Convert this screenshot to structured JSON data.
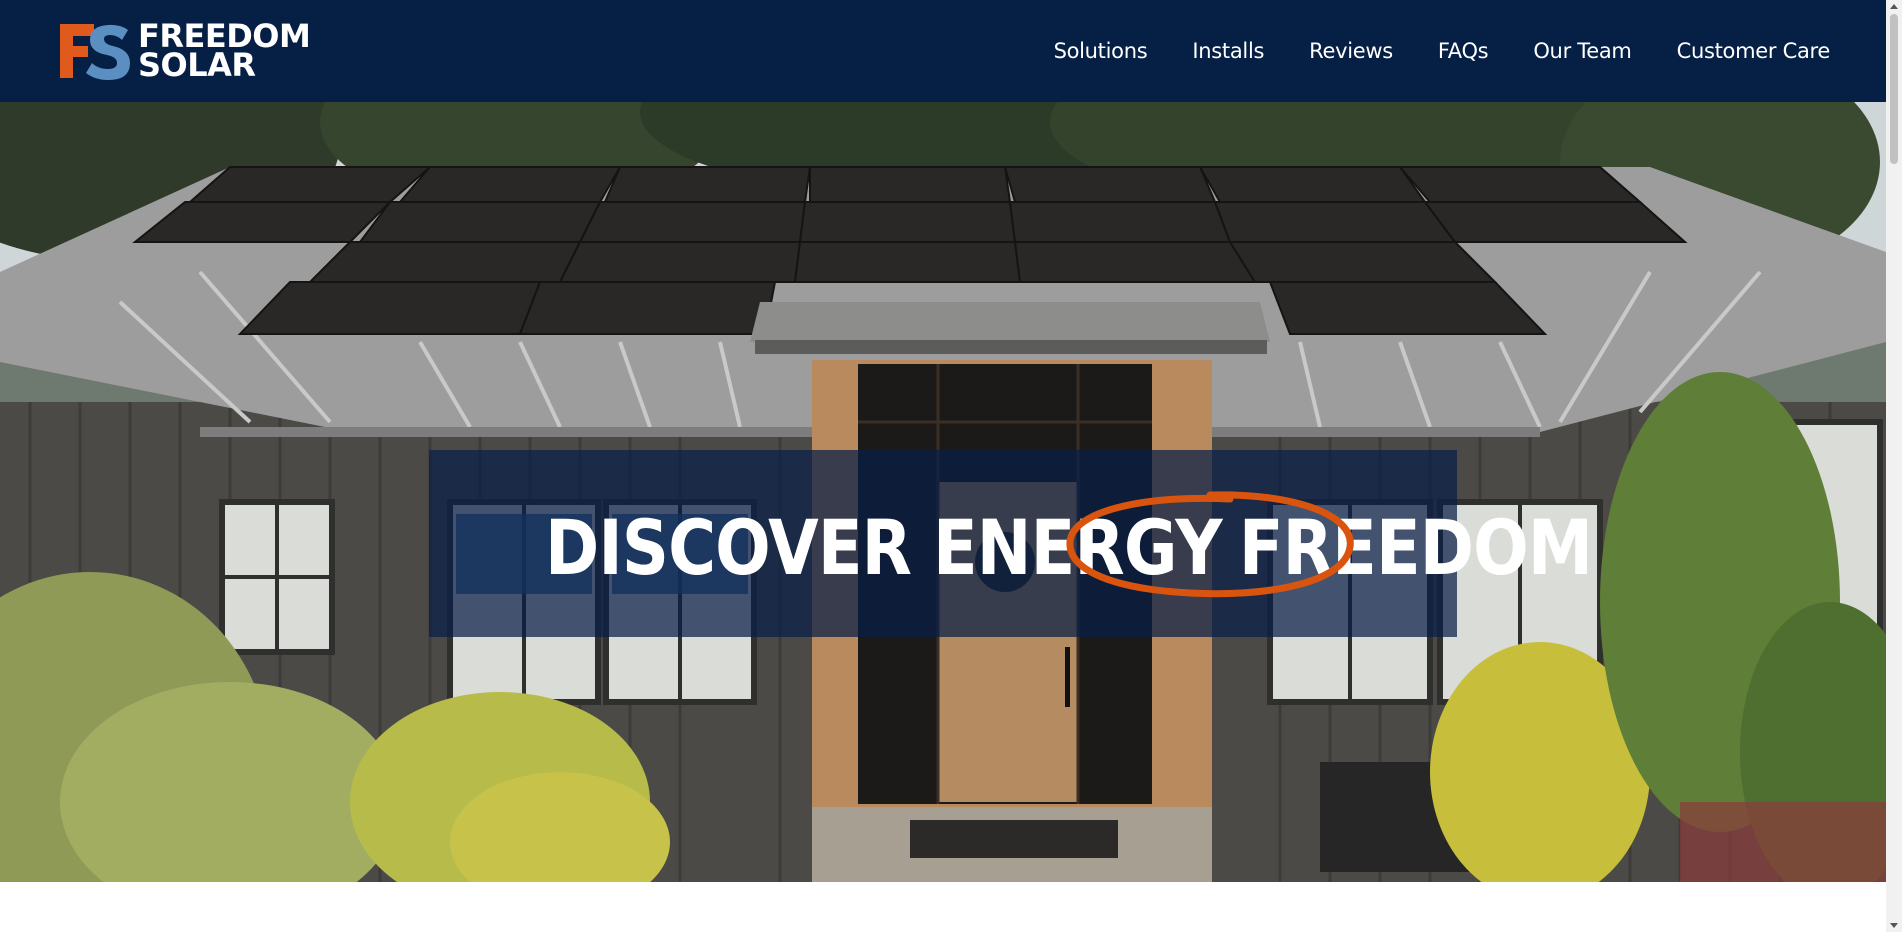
{
  "brand": {
    "mark": "FS",
    "line1": "FREEDOM",
    "line2": "SOLAR",
    "colors": {
      "navy": "#061f45",
      "orange": "#e05a1e",
      "blue": "#5b8fc2"
    }
  },
  "nav": {
    "items": [
      {
        "label": "Solutions"
      },
      {
        "label": "Installs"
      },
      {
        "label": "Reviews"
      },
      {
        "label": "FAQs"
      },
      {
        "label": "Our Team"
      },
      {
        "label": "Customer Care"
      }
    ]
  },
  "hero": {
    "headline_part1": "DISCOVER ENERGY",
    "headline_part2": "FREEDOM",
    "image": "house-with-solar-panels",
    "circle_color": "#d9540f"
  }
}
